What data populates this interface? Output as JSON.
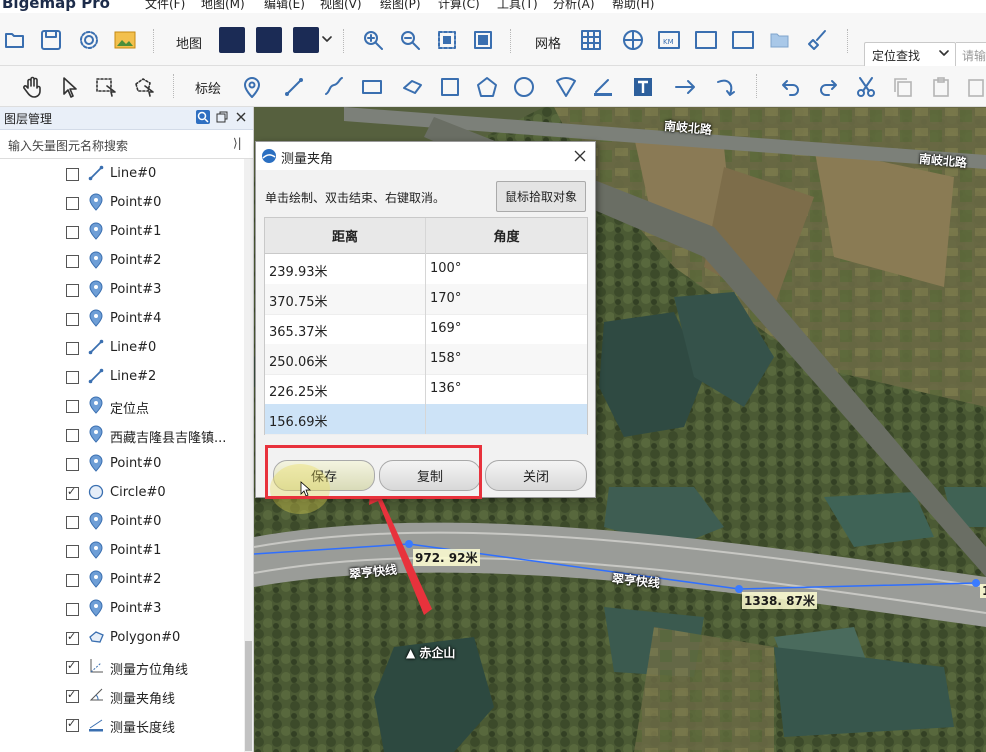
{
  "app": {
    "title": "Bigemap Pro"
  },
  "menu": [
    "文件(F)",
    "地图(M)",
    "编辑(E)",
    "视图(V)",
    "绘图(P)",
    "计算(C)",
    "工具(T)",
    "分析(A)",
    "帮助(H)"
  ],
  "toolbar1": {
    "map_label": "地图",
    "grid_label": "网格",
    "locate_mode": "定位查找",
    "search_placeholder": "请输"
  },
  "toolbar2": {
    "annotate_label": "标绘"
  },
  "layer_panel": {
    "title": "图层管理",
    "filter_placeholder": "输入矢量图元名称搜索",
    "items": [
      {
        "label": "Line#0",
        "icon": "line-icon",
        "checked": false
      },
      {
        "label": "Point#0",
        "icon": "point-icon",
        "checked": false
      },
      {
        "label": "Point#1",
        "icon": "point-icon",
        "checked": false
      },
      {
        "label": "Point#2",
        "icon": "point-icon",
        "checked": false
      },
      {
        "label": "Point#3",
        "icon": "point-icon",
        "checked": false
      },
      {
        "label": "Point#4",
        "icon": "point-icon",
        "checked": false
      },
      {
        "label": "Line#0",
        "icon": "line-icon",
        "checked": false
      },
      {
        "label": "Line#2",
        "icon": "line-icon",
        "checked": false
      },
      {
        "label": "定位点",
        "icon": "point-icon",
        "checked": false
      },
      {
        "label": "西藏吉隆县吉隆镇...",
        "icon": "point-icon",
        "checked": false
      },
      {
        "label": "Point#0",
        "icon": "point-icon",
        "checked": false
      },
      {
        "label": "Circle#0",
        "icon": "circle-icon",
        "checked": true
      },
      {
        "label": "Point#0",
        "icon": "point-icon",
        "checked": false
      },
      {
        "label": "Point#1",
        "icon": "point-icon",
        "checked": false
      },
      {
        "label": "Point#2",
        "icon": "point-icon",
        "checked": false
      },
      {
        "label": "Point#3",
        "icon": "point-icon",
        "checked": false
      },
      {
        "label": "Polygon#0",
        "icon": "polygon-icon",
        "checked": true
      },
      {
        "label": "测量方位角线",
        "icon": "azimuth-icon",
        "checked": true
      },
      {
        "label": "测量夹角线",
        "icon": "angle-icon",
        "checked": true
      },
      {
        "label": "测量长度线",
        "icon": "length-icon",
        "checked": true
      }
    ]
  },
  "map": {
    "labels": {
      "road_north_1": "南岐北路",
      "road_north_2": "南岐北路",
      "expressway_1": "翠亨快线",
      "expressway_2": "翠亨快线",
      "mountain": "赤企山"
    },
    "measures": {
      "m1": "972. 92米",
      "m2": "1338. 87米",
      "m3": "1"
    }
  },
  "dialog": {
    "title": "测量夹角",
    "hint": "单击绘制、双击结束、右键取消。",
    "pick_button": "鼠标拾取对象",
    "columns": [
      "距离",
      "角度"
    ],
    "rows": [
      {
        "distance": "239.93米",
        "angle": "100°"
      },
      {
        "distance": "370.75米",
        "angle": "170°"
      },
      {
        "distance": "365.37米",
        "angle": "169°"
      },
      {
        "distance": "250.06米",
        "angle": "158°"
      },
      {
        "distance": "226.25米",
        "angle": "136°"
      },
      {
        "distance": "156.69米",
        "angle": ""
      }
    ],
    "buttons": {
      "save": "保存",
      "copy": "复制",
      "close": "关闭"
    }
  },
  "colors": {
    "accent_blue": "#3a6fb0",
    "highlight_red": "#e8323c",
    "selected_row": "#cde3f7"
  }
}
